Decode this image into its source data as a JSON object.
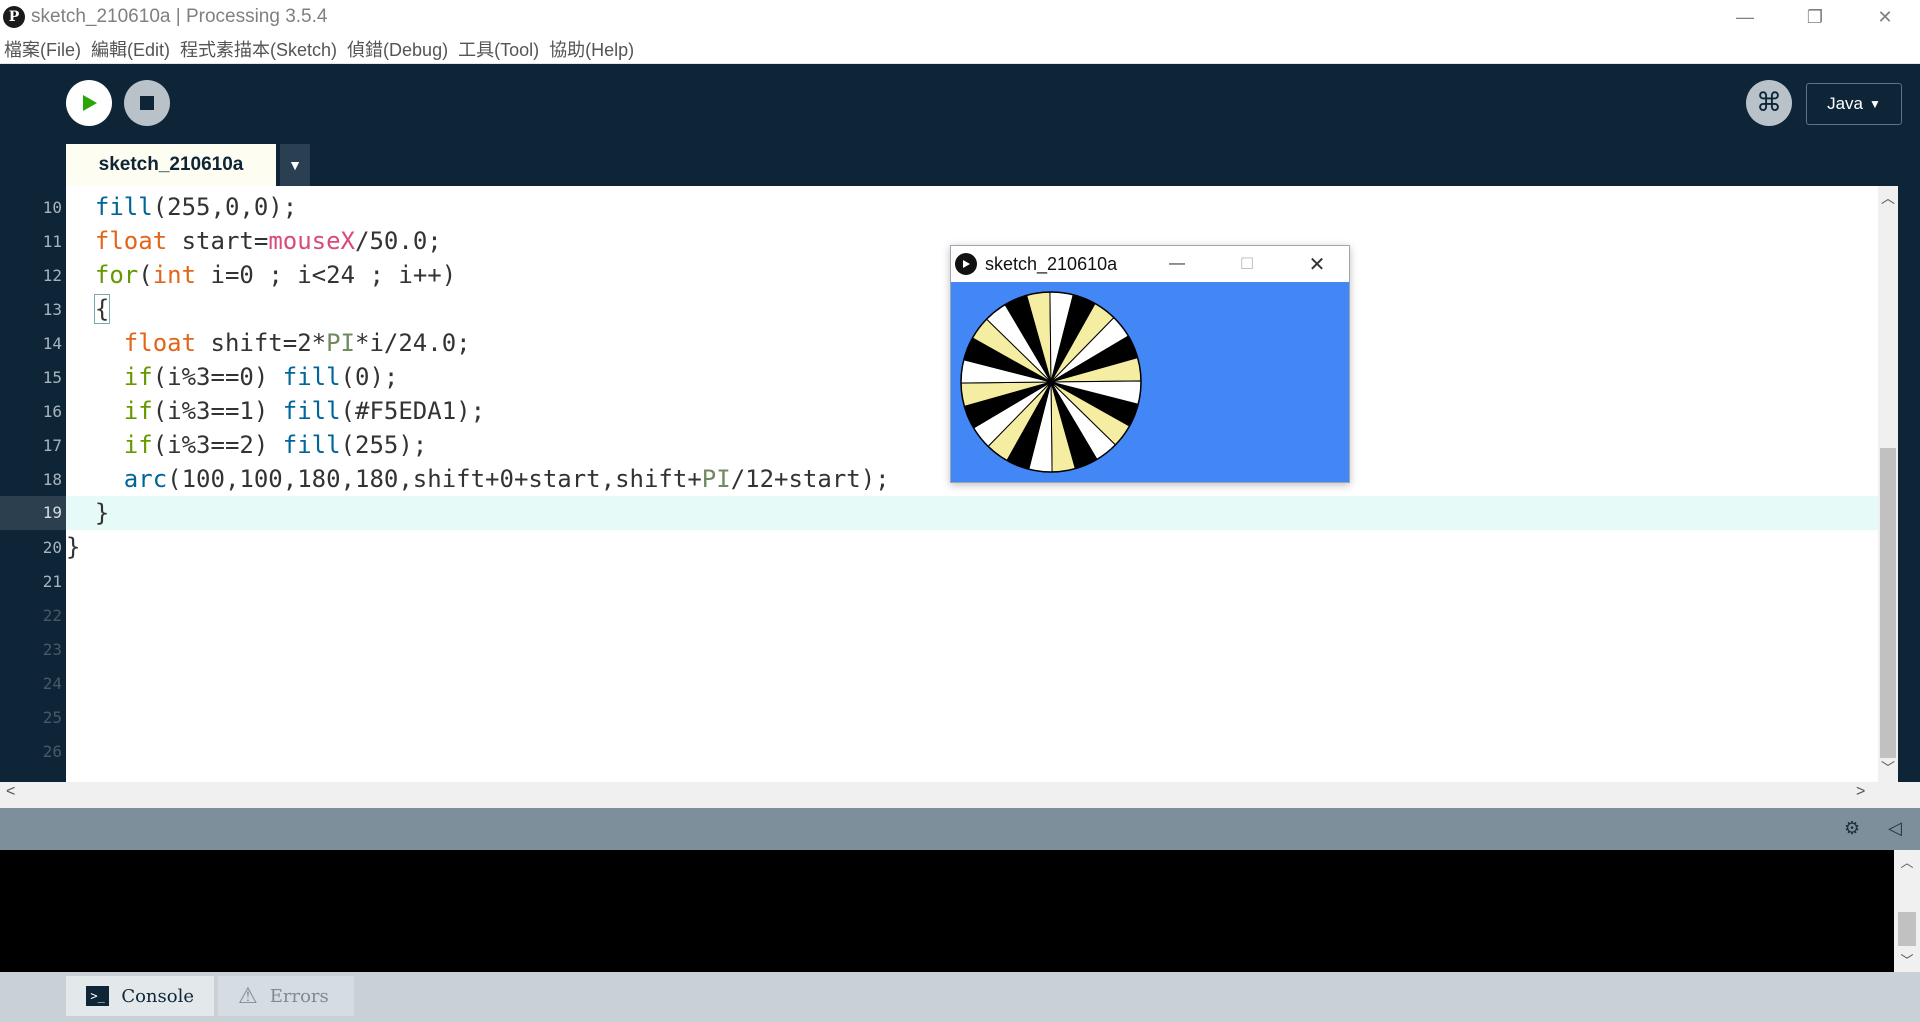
{
  "window": {
    "title": "sketch_210610a | Processing 3.5.4",
    "app_icon_glyph": "P",
    "controls": {
      "minimize": "—",
      "restore": "❐",
      "close": "✕"
    }
  },
  "menu": [
    "檔案(File)",
    "編輯(Edit)",
    "程式素描本(Sketch)",
    "偵錯(Debug)",
    "工具(Tool)",
    "協助(Help)"
  ],
  "toolbar": {
    "run_icon": "play-icon",
    "stop_icon": "stop-icon",
    "debug_glyph": "⌘",
    "mode_label": "Java",
    "mode_arrow": "▼"
  },
  "tabs": [
    {
      "label": "sketch_210610a",
      "active": true
    }
  ],
  "tab_menu_arrow": "▼",
  "editor": {
    "lines": [
      {
        "num": "10",
        "active": false
      },
      {
        "num": "11",
        "active": false
      },
      {
        "num": "12",
        "active": false
      },
      {
        "num": "13",
        "active": false
      },
      {
        "num": "14",
        "active": false
      },
      {
        "num": "15",
        "active": false
      },
      {
        "num": "16",
        "active": false
      },
      {
        "num": "17",
        "active": false
      },
      {
        "num": "18",
        "active": false
      },
      {
        "num": "19",
        "active": true
      },
      {
        "num": "20",
        "active": false
      },
      {
        "num": "21",
        "active": false
      },
      {
        "num": "22",
        "active": false
      },
      {
        "num": "23",
        "active": false
      },
      {
        "num": "24",
        "active": false
      },
      {
        "num": "25",
        "active": false
      },
      {
        "num": "26",
        "active": false
      }
    ],
    "code": [
      [
        [
          "  ",
          ""
        ],
        [
          "fill",
          "fn"
        ],
        [
          "(255,0,0);",
          ""
        ]
      ],
      [
        [
          "  ",
          ""
        ],
        [
          "float",
          "kw"
        ],
        [
          " start=",
          ""
        ],
        [
          "mouseX",
          "sys"
        ],
        [
          "/50.0;",
          ""
        ]
      ],
      [
        [
          "  ",
          ""
        ],
        [
          "for",
          "ctl"
        ],
        [
          "(",
          ""
        ],
        [
          "int",
          "kw"
        ],
        [
          " i=0 ; i<24 ; i++)",
          ""
        ]
      ],
      [
        [
          "  ",
          ""
        ],
        [
          "{",
          "bracket"
        ]
      ],
      [
        [
          "    ",
          ""
        ],
        [
          "float",
          "kw"
        ],
        [
          " shift=2*",
          ""
        ],
        [
          "PI",
          "const"
        ],
        [
          "*i/24.0;",
          ""
        ]
      ],
      [
        [
          "    ",
          ""
        ],
        [
          "if",
          "ctl"
        ],
        [
          "(i%3==0) ",
          ""
        ],
        [
          "fill",
          "fn"
        ],
        [
          "(0);",
          ""
        ]
      ],
      [
        [
          "    ",
          ""
        ],
        [
          "if",
          "ctl"
        ],
        [
          "(i%3==1) ",
          ""
        ],
        [
          "fill",
          "fn"
        ],
        [
          "(#F5EDA1);",
          ""
        ]
      ],
      [
        [
          "    ",
          ""
        ],
        [
          "if",
          "ctl"
        ],
        [
          "(i%3==2) ",
          ""
        ],
        [
          "fill",
          "fn"
        ],
        [
          "(255);",
          ""
        ]
      ],
      [
        [
          "    ",
          ""
        ],
        [
          "arc",
          "fn"
        ],
        [
          "(100,100,180,180,shift+0+start,shift+",
          ""
        ],
        [
          "PI",
          "const"
        ],
        [
          "/12+start);",
          ""
        ]
      ],
      [
        [
          "  }",
          ""
        ]
      ],
      [
        [
          "}",
          ""
        ]
      ],
      [
        [
          "",
          ""
        ]
      ],
      [
        [
          "",
          ""
        ]
      ],
      [
        [
          "",
          ""
        ]
      ],
      [
        [
          "",
          ""
        ]
      ],
      [
        [
          "",
          ""
        ]
      ],
      [
        [
          "",
          ""
        ]
      ]
    ]
  },
  "sketch_window": {
    "title": "sketch_210610a",
    "controls": {
      "minimize": "—",
      "maximize": "☐",
      "close": "✕"
    },
    "background": "#4287F5",
    "wheel_segments": 24,
    "fills": [
      "#000000",
      "#F5EDA1",
      "#FFFFFF"
    ],
    "start_offset": 0.25
  },
  "console": {
    "tabs": [
      {
        "label": "Console",
        "icon": "console-icon",
        "active": true
      },
      {
        "label": "Errors",
        "icon": "warning-icon",
        "active": false
      }
    ],
    "console_glyph": ">_",
    "warning_glyph": "⚠",
    "header_icons": {
      "settings": "⚙",
      "collapse": "◁"
    }
  },
  "colors": {
    "toolbar_bg": "#0E2537",
    "editor_bg": "#FFFFFF",
    "current_line": "#E6FBF7",
    "keyword": "#E2661A",
    "function": "#006699",
    "control": "#669900"
  }
}
